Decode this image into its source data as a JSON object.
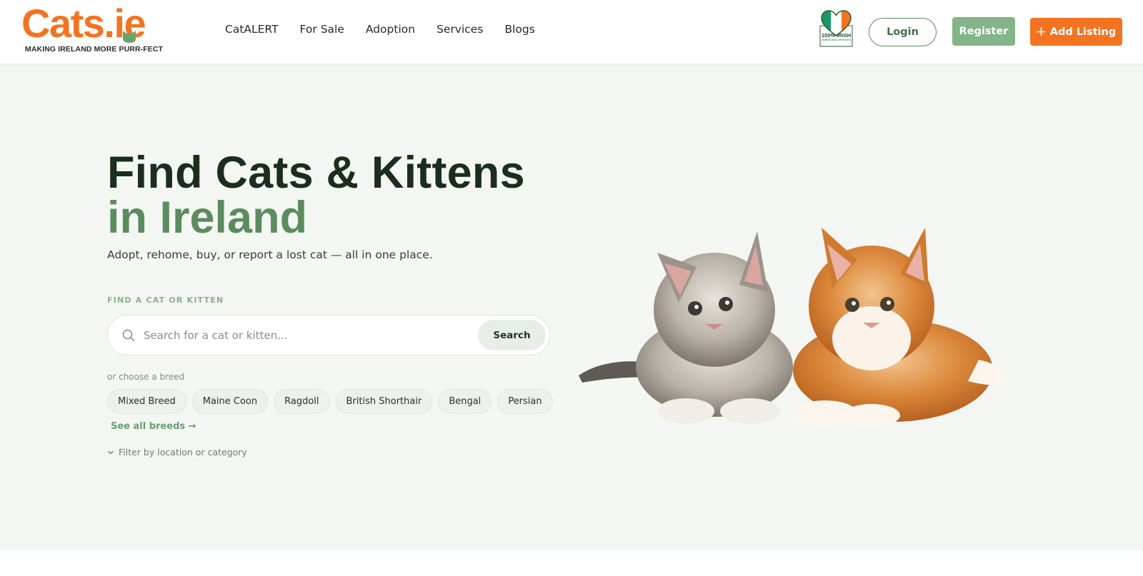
{
  "header": {
    "logo": {
      "text": "Cats.ie",
      "tagline": "MAKING IRELAND MORE PURR-FECT"
    },
    "nav": [
      "CatALERT",
      "For Sale",
      "Adoption",
      "Services",
      "Blogs"
    ],
    "badge": {
      "text": "100% IRISH",
      "subtext": "OWNED AND OPERATED"
    },
    "login_label": "Login",
    "register_label": "Register",
    "add_listing_label": "Add Listing"
  },
  "hero": {
    "title_line1": "Find Cats & Kittens",
    "title_line2": "in Ireland",
    "subtitle": "Adopt, rehome, buy, or report a lost cat — all in one place.",
    "find_label": "FIND A CAT OR KITTEN",
    "search": {
      "placeholder": "Search for a cat or kitten...",
      "button_label": "Search"
    },
    "choose_label": "or choose a breed",
    "breeds": [
      "Mixed Breed",
      "Maine Coon",
      "Ragdoll",
      "British Shorthair",
      "Bengal",
      "Persian"
    ],
    "see_all_label": "See all breeds →",
    "filter_label": "Filter by location or category"
  },
  "colors": {
    "brand_orange": "#f47321",
    "brand_green": "#5b8c5f",
    "register_green": "#84b48a",
    "hero_bg": "#f4f6f3",
    "title_dark": "#1b2e1d"
  }
}
